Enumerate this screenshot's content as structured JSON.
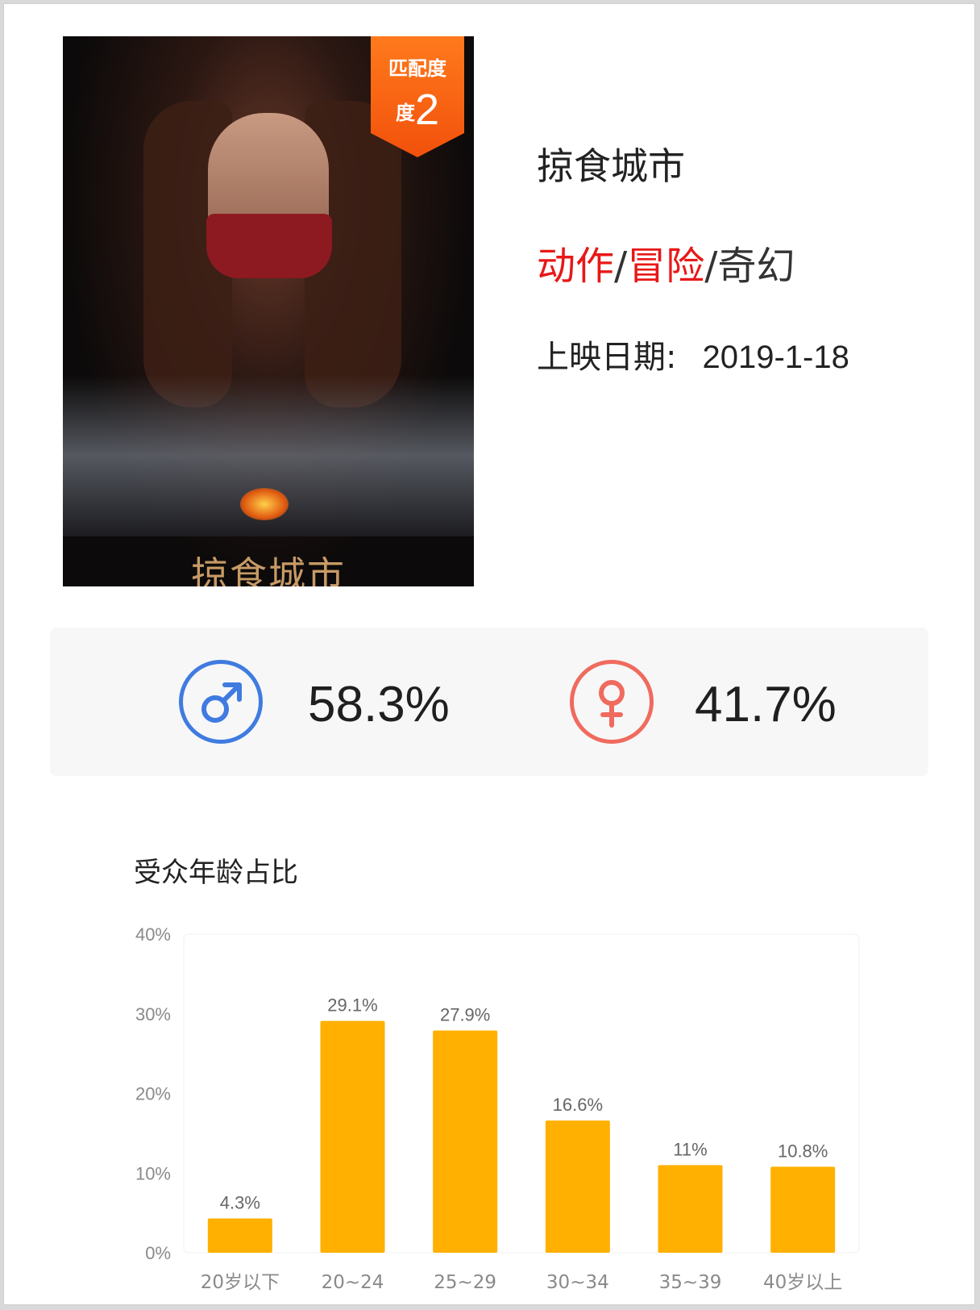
{
  "movie": {
    "title": "掠食城市",
    "genres": [
      {
        "label": "动作",
        "highlight": true
      },
      {
        "label": "冒险",
        "highlight": true
      },
      {
        "label": "奇幻",
        "highlight": false
      }
    ],
    "genre_separator": "/",
    "release_label": "上映日期:",
    "release_date": "2019-1-18",
    "poster_title": "掠食城市"
  },
  "badge": {
    "line1": "匹配度",
    "line2_prefix": "度",
    "number": "2"
  },
  "gender": {
    "male_icon": "male-symbol-icon",
    "female_icon": "female-symbol-icon",
    "male_pct": "58.3%",
    "female_pct": "41.7%",
    "male_color": "#3f7be0",
    "female_color": "#f06a5e"
  },
  "chart_data": {
    "type": "bar",
    "title": "受众年龄占比",
    "categories": [
      "20岁以下",
      "20~24",
      "25~29",
      "30~34",
      "35~39",
      "40岁以上"
    ],
    "values": [
      4.3,
      29.1,
      27.9,
      16.6,
      11.0,
      10.8
    ],
    "value_labels": [
      "4.3%",
      "29.1%",
      "27.9%",
      "16.6%",
      "11%",
      "10.8%"
    ],
    "ylim": [
      0,
      40
    ],
    "yticks": [
      "0%",
      "10%",
      "20%",
      "30%",
      "40%"
    ],
    "bar_color": "#ffb000",
    "grid": false
  }
}
